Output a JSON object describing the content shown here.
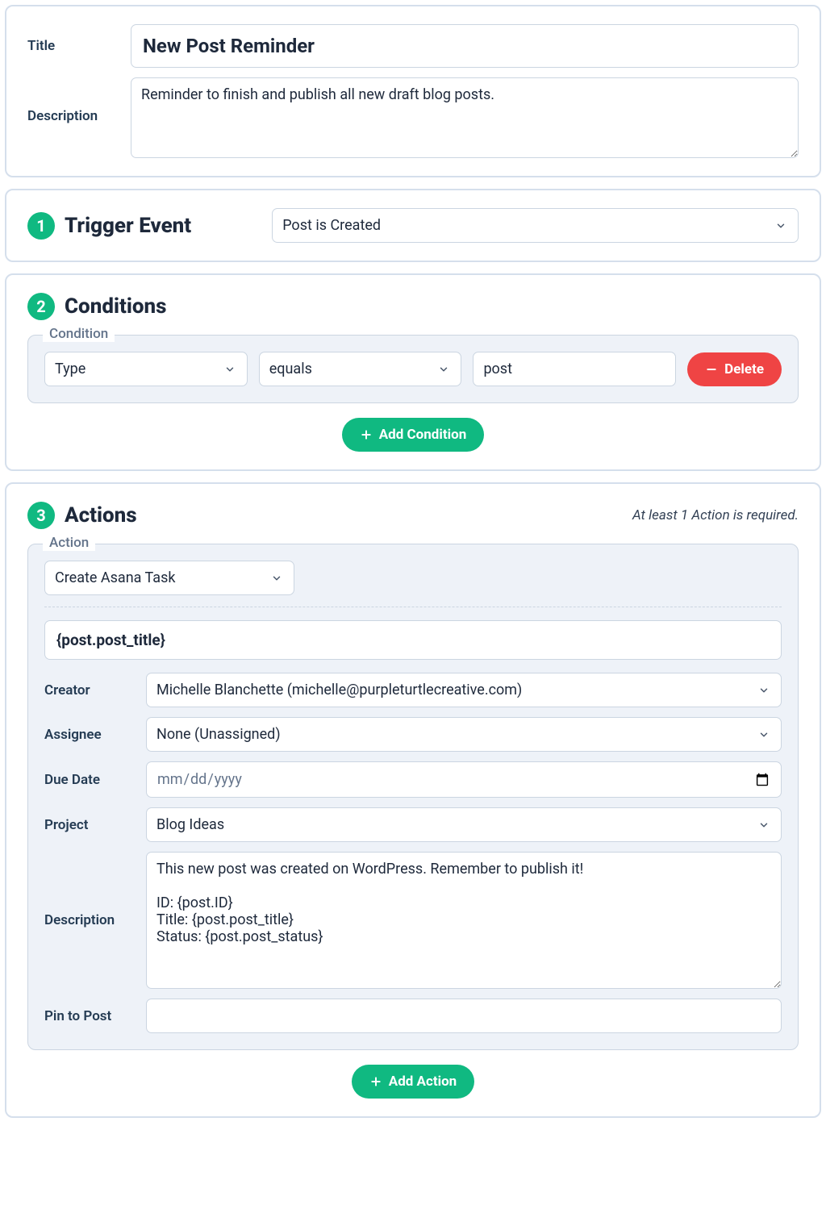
{
  "header": {
    "title_label": "Title",
    "title_value": "New Post Reminder",
    "description_label": "Description",
    "description_value": "Reminder to finish and publish all new draft blog posts."
  },
  "trigger": {
    "step_num": "1",
    "heading": "Trigger Event",
    "selected": "Post is Created"
  },
  "conditions": {
    "step_num": "2",
    "heading": "Conditions",
    "fieldset_legend": "Condition",
    "row": {
      "field": "Type",
      "operator": "equals",
      "value": "post"
    },
    "delete_label": "Delete",
    "add_label": "Add Condition"
  },
  "actions": {
    "step_num": "3",
    "heading": "Actions",
    "hint": "At least 1 Action is required.",
    "fieldset_legend": "Action",
    "action_type": "Create Asana Task",
    "task_title": "{post.post_title}",
    "fields": {
      "creator_label": "Creator",
      "creator_value": "Michelle Blanchette (michelle@purpleturtlecreative.com)",
      "assignee_label": "Assignee",
      "assignee_value": "None (Unassigned)",
      "due_label": "Due Date",
      "due_placeholder": "mm/dd/yyyy",
      "project_label": "Project",
      "project_value": "Blog Ideas",
      "description_label": "Description",
      "description_value": "This new post was created on WordPress. Remember to publish it!\n\nID: {post.ID}\nTitle: {post.post_title}\nStatus: {post.post_status}",
      "pin_label": "Pin to Post",
      "pin_value": ""
    },
    "add_label": "Add Action"
  }
}
